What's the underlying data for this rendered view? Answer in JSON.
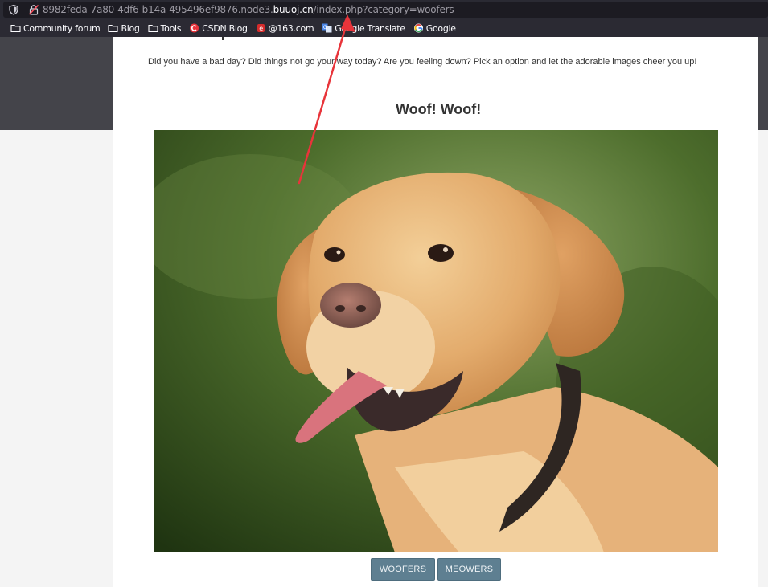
{
  "browser": {
    "url_prefix": "8982feda-7a80-4df6-b14a-495496ef9876.node3.",
    "url_domain": "buuoj.cn",
    "url_path": "/index.php?category=woofers",
    "bookmarks": [
      {
        "label": "Community forum",
        "icon": "folder-icon"
      },
      {
        "label": "Blog",
        "icon": "folder-icon"
      },
      {
        "label": "Tools",
        "icon": "folder-icon"
      },
      {
        "label": "CSDN Blog",
        "icon": "csdn-icon"
      },
      {
        "label": "@163.com",
        "icon": "mail163-icon"
      },
      {
        "label": "Google Translate",
        "icon": "translate-icon"
      },
      {
        "label": "Google",
        "icon": "google-icon"
      }
    ]
  },
  "page": {
    "intro": "Did you have a bad day? Did things not go your way today? Are you feeling down? Pick an option and let the adorable images cheer you up!",
    "heading": "Woof! Woof!",
    "image_subject": "golden labrador dog photo",
    "buttons": {
      "woofers": "WOOFERS",
      "meowers": "MEOWERS"
    }
  },
  "colors": {
    "accent_button": "#5e7f91",
    "annotation_arrow": "#e8343a"
  }
}
